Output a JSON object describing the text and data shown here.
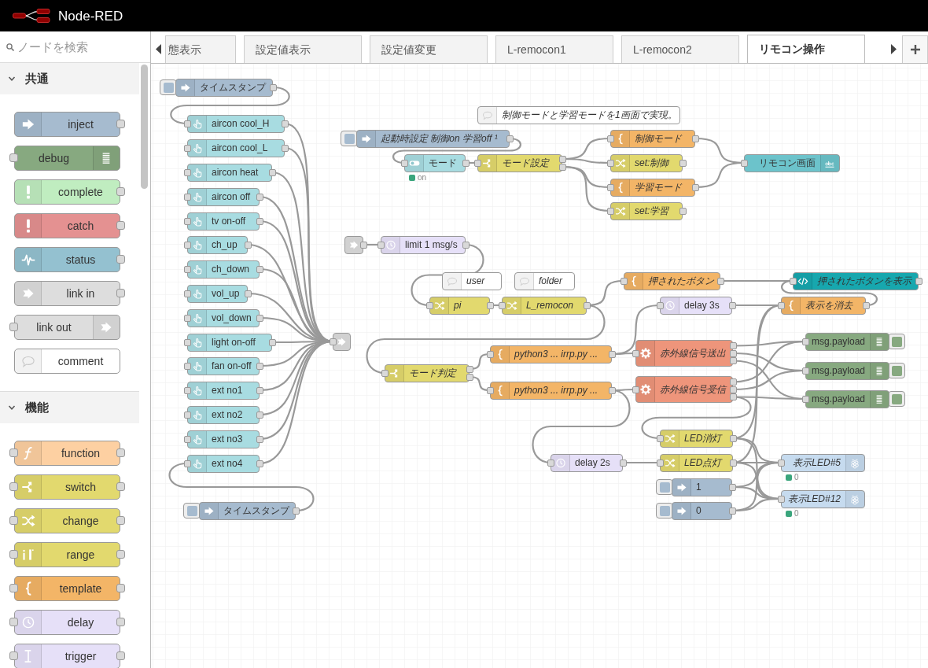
{
  "header": {
    "title": "Node-RED"
  },
  "palette": {
    "search": {
      "placeholder": "ノードを検索"
    },
    "categories": [
      {
        "label": "共通",
        "expanded": true,
        "nodes": [
          {
            "kind": "inject",
            "label": "inject"
          },
          {
            "kind": "debug",
            "label": "debug"
          },
          {
            "kind": "complete",
            "label": "complete"
          },
          {
            "kind": "catch",
            "label": "catch"
          },
          {
            "kind": "status",
            "label": "status"
          },
          {
            "kind": "linkin",
            "label": "link in"
          },
          {
            "kind": "linkout",
            "label": "link out"
          },
          {
            "kind": "comment",
            "label": "comment"
          }
        ]
      },
      {
        "label": "機能",
        "expanded": true,
        "nodes": [
          {
            "kind": "function",
            "label": "function"
          },
          {
            "kind": "switch",
            "label": "switch"
          },
          {
            "kind": "change",
            "label": "change"
          },
          {
            "kind": "range",
            "label": "range"
          },
          {
            "kind": "template",
            "label": "template"
          },
          {
            "kind": "delay",
            "label": "delay"
          },
          {
            "kind": "trigger",
            "label": "trigger"
          }
        ]
      }
    ]
  },
  "tabs": [
    {
      "label": "態表示",
      "selected": false
    },
    {
      "label": "設定値表示",
      "selected": false
    },
    {
      "label": "設定値変更",
      "selected": false
    },
    {
      "label": "L-remocon1",
      "selected": false
    },
    {
      "label": "L-remocon2",
      "selected": false
    },
    {
      "label": "リモコン操作",
      "selected": true
    }
  ],
  "flow": {
    "nodes": [
      {
        "kind": "inject",
        "label": "タイムスタンプ",
        "italic": false
      },
      {
        "kind": "button",
        "label": "aircon cool_H",
        "italic": false
      },
      {
        "kind": "button",
        "label": "aircon cool_L",
        "italic": false
      },
      {
        "kind": "button",
        "label": "aircon heat",
        "italic": false
      },
      {
        "kind": "button",
        "label": "aircon off",
        "italic": false
      },
      {
        "kind": "button",
        "label": "tv on-off",
        "italic": false
      },
      {
        "kind": "button",
        "label": "ch_up",
        "italic": false
      },
      {
        "kind": "button",
        "label": "ch_down",
        "italic": false
      },
      {
        "kind": "button",
        "label": "vol_up",
        "italic": false
      },
      {
        "kind": "button",
        "label": "vol_down",
        "italic": false
      },
      {
        "kind": "button",
        "label": "light on-off",
        "italic": false
      },
      {
        "kind": "button",
        "label": "fan on-off",
        "italic": false
      },
      {
        "kind": "button",
        "label": "ext no1",
        "italic": false
      },
      {
        "kind": "button",
        "label": "ext no2",
        "italic": false
      },
      {
        "kind": "button",
        "label": "ext no3",
        "italic": false
      },
      {
        "kind": "button",
        "label": "ext no4",
        "italic": false
      },
      {
        "kind": "inject",
        "label": "タイムスタンプ",
        "italic": false
      },
      {
        "kind": "linkout"
      },
      {
        "kind": "comment",
        "label": "制御モードと学習モードを1画面で実現。",
        "italic": true
      },
      {
        "kind": "inject",
        "label": "起動時設定 制御on 学習off ¹",
        "italic": true
      },
      {
        "kind": "toggle",
        "label": "モード",
        "italic": false,
        "status": {
          "text": "on",
          "color": "#3aa57c"
        }
      },
      {
        "kind": "switch",
        "label": "モード設定",
        "italic": true
      },
      {
        "kind": "template",
        "label": "制御モード",
        "italic": true
      },
      {
        "kind": "change",
        "label": "set:制御",
        "italic": true
      },
      {
        "kind": "template",
        "label": "学習モード",
        "italic": true
      },
      {
        "kind": "change",
        "label": "set:学習",
        "italic": true
      },
      {
        "kind": "text",
        "label": "リモコン画面",
        "italic": false
      },
      {
        "kind": "linkin"
      },
      {
        "kind": "delay",
        "label": "limit 1 msg/s",
        "italic": false
      },
      {
        "kind": "comment",
        "label": "user",
        "italic": true
      },
      {
        "kind": "comment",
        "label": "folder",
        "italic": true
      },
      {
        "kind": "change",
        "label": "pi",
        "italic": true
      },
      {
        "kind": "change",
        "label": "L_remocon",
        "italic": true
      },
      {
        "kind": "template",
        "label": "押されたボタン",
        "italic": true
      },
      {
        "kind": "html",
        "label": "押されたボタンを表示",
        "italic": true
      },
      {
        "kind": "delay",
        "label": "delay 3s",
        "italic": false
      },
      {
        "kind": "template",
        "label": "表示を消去",
        "italic": true
      },
      {
        "kind": "switch",
        "label": "モード判定",
        "italic": true
      },
      {
        "kind": "template",
        "label": "python3 ... irrp.py ...",
        "italic": true
      },
      {
        "kind": "exec",
        "label": "赤外線信号送出",
        "italic": true
      },
      {
        "kind": "template",
        "label": "python3 ... irrp.py ...",
        "italic": true
      },
      {
        "kind": "exec",
        "label": "赤外線信号受信",
        "italic": true
      },
      {
        "kind": "debug",
        "label": "msg.payload",
        "italic": false
      },
      {
        "kind": "debug",
        "label": "msg.payload",
        "italic": false
      },
      {
        "kind": "debug",
        "label": "msg.payload",
        "italic": false
      },
      {
        "kind": "change",
        "label": "LED消灯",
        "italic": true
      },
      {
        "kind": "delay",
        "label": "delay 2s",
        "italic": false
      },
      {
        "kind": "change",
        "label": "LED点灯",
        "italic": true
      },
      {
        "kind": "inject",
        "label": "1",
        "italic": false
      },
      {
        "kind": "inject",
        "label": "0",
        "italic": false
      },
      {
        "kind": "gpio",
        "label": "表示LED#5",
        "italic": true,
        "status": {
          "text": "0",
          "color": "#3aa57c"
        }
      },
      {
        "kind": "gpio",
        "label": "表示LED#12",
        "italic": true,
        "status": {
          "text": "0",
          "color": "#3aa57c"
        }
      }
    ]
  }
}
